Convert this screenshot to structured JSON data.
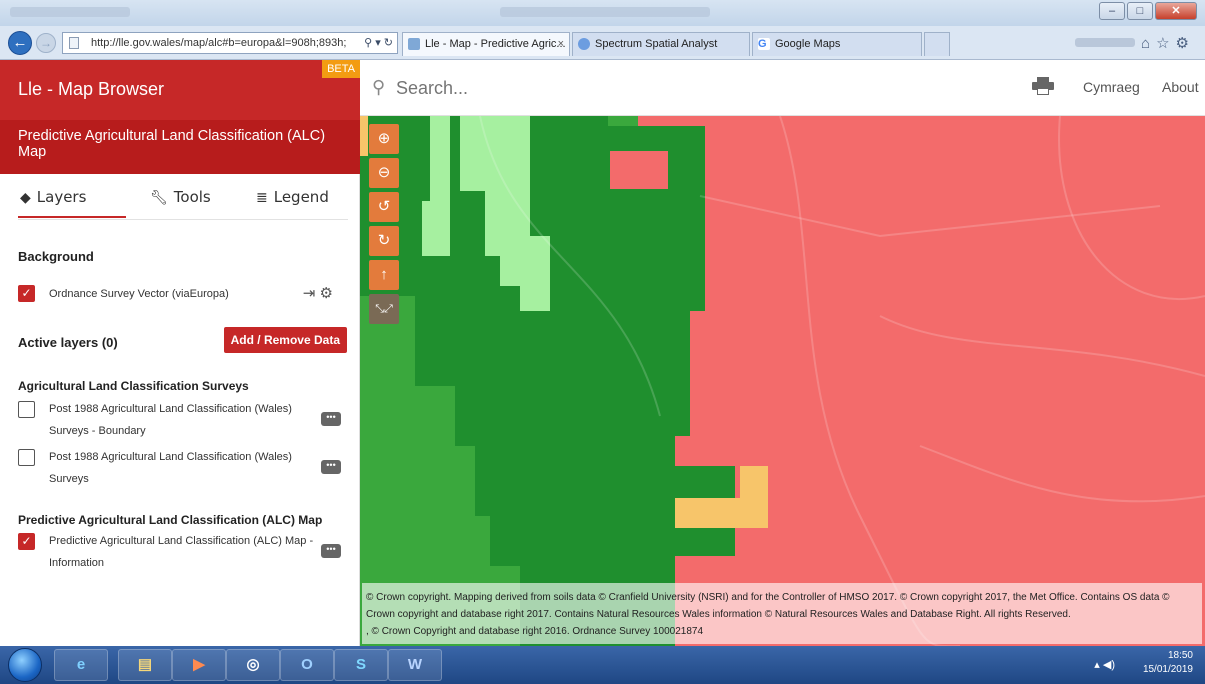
{
  "browser": {
    "url": "http://lle.gov.wales/map/alc#b=europa&l=908h;893h;",
    "tabs": [
      {
        "label": "Lle - Map - Predictive Agric...",
        "active": true
      },
      {
        "label": "Spectrum Spatial Analyst",
        "active": false
      },
      {
        "label": "Google Maps",
        "active": false
      }
    ],
    "tab_close": "×"
  },
  "app": {
    "title": "Lle - Map Browser",
    "beta": "BETA",
    "map_title": "Predictive Agricultural Land Classification (ALC) Map"
  },
  "sidebar": {
    "tabs": [
      {
        "label": "Layers",
        "icon": "layers-icon",
        "active": true
      },
      {
        "label": "Tools",
        "icon": "wrench-icon",
        "active": false
      },
      {
        "label": "Legend",
        "icon": "list-icon",
        "active": false
      }
    ],
    "background_heading": "Background",
    "background_layer": {
      "label": "Ordnance Survey Vector (viaEuropa)",
      "checked": true
    },
    "active_layers_heading": "Active layers (0)",
    "add_remove_button": "Add / Remove Data",
    "groups": [
      {
        "heading": "Agricultural Land Classification Surveys",
        "items": [
          {
            "label": "Post 1988 Agricultural Land Classification (Wales) Surveys - Boundary",
            "checked": false
          },
          {
            "label": "Post 1988 Agricultural Land Classification (Wales) Surveys",
            "checked": false
          }
        ]
      },
      {
        "heading": "Predictive Agricultural Land Classification (ALC) Map",
        "items": [
          {
            "label": "Predictive Agricultural Land Classification (ALC) Map - Information",
            "checked": true
          }
        ]
      }
    ]
  },
  "topbar": {
    "search_placeholder": "Search...",
    "links": [
      "Cymraeg",
      "About"
    ]
  },
  "map": {
    "colors": {
      "grade_red": "#f36b6b",
      "grade_dark_green": "#1f8f2e",
      "grade_green": "#3aa83d",
      "grade_light_green": "#a6f0a0",
      "grade_yellow": "#f7c56a"
    },
    "attribution": [
      "© Crown copyright. Mapping derived from soils data © Cranfield University (NSRI) and for the Controller of HMSO 2017. © Crown copyright 2017, the Met Office. Contains OS data © Crown copyright and database right 2017. Contains Natural Resources Wales information © Natural Resources Wales and Database Right. All rights Reserved.",
      ", © Crown Copyright and database right 2016. Ordnance Survey 100021874"
    ]
  },
  "taskbar": {
    "time": "18:50",
    "date": "15/01/2019"
  }
}
